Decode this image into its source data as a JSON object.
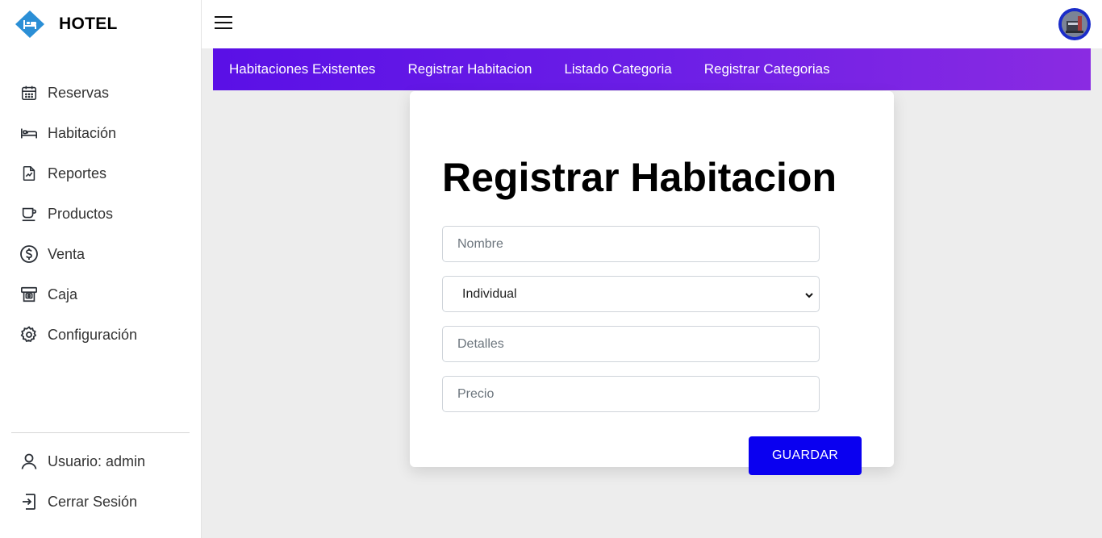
{
  "brand": {
    "name": "HOTEL",
    "logo_icon": "hotel-bed-icon",
    "logo_color": "#2b8fd6"
  },
  "sidebar": {
    "items": [
      {
        "label": "Reservas",
        "icon": "calendar-icon"
      },
      {
        "label": "Habitación",
        "icon": "bed-icon"
      },
      {
        "label": "Reportes",
        "icon": "report-icon"
      },
      {
        "label": "Productos",
        "icon": "coffee-cup-icon"
      },
      {
        "label": "Venta",
        "icon": "dollar-circle-icon"
      },
      {
        "label": "Caja",
        "icon": "cash-register-icon"
      },
      {
        "label": "Configuración",
        "icon": "gear-icon"
      }
    ],
    "bottom": [
      {
        "label": "Usuario: admin",
        "icon": "user-icon"
      },
      {
        "label": "Cerrar Sesión",
        "icon": "logout-icon"
      }
    ]
  },
  "tabs": [
    {
      "label": "Habitaciones Existentes"
    },
    {
      "label": "Registrar Habitacion"
    },
    {
      "label": "Listado Categoria"
    },
    {
      "label": "Registrar Categorias"
    }
  ],
  "form": {
    "title": "Registrar Habitacion",
    "name_placeholder": "Nombre",
    "category_value": "Individual",
    "details_placeholder": "Detalles",
    "price_placeholder": "Precio",
    "save_label": "GUARDAR"
  },
  "colors": {
    "tab_gradient_start": "#5a10e6",
    "tab_gradient_end": "#8a2be2",
    "save_button": "#0a00f0",
    "avatar_ring": "#1a2cc9"
  }
}
